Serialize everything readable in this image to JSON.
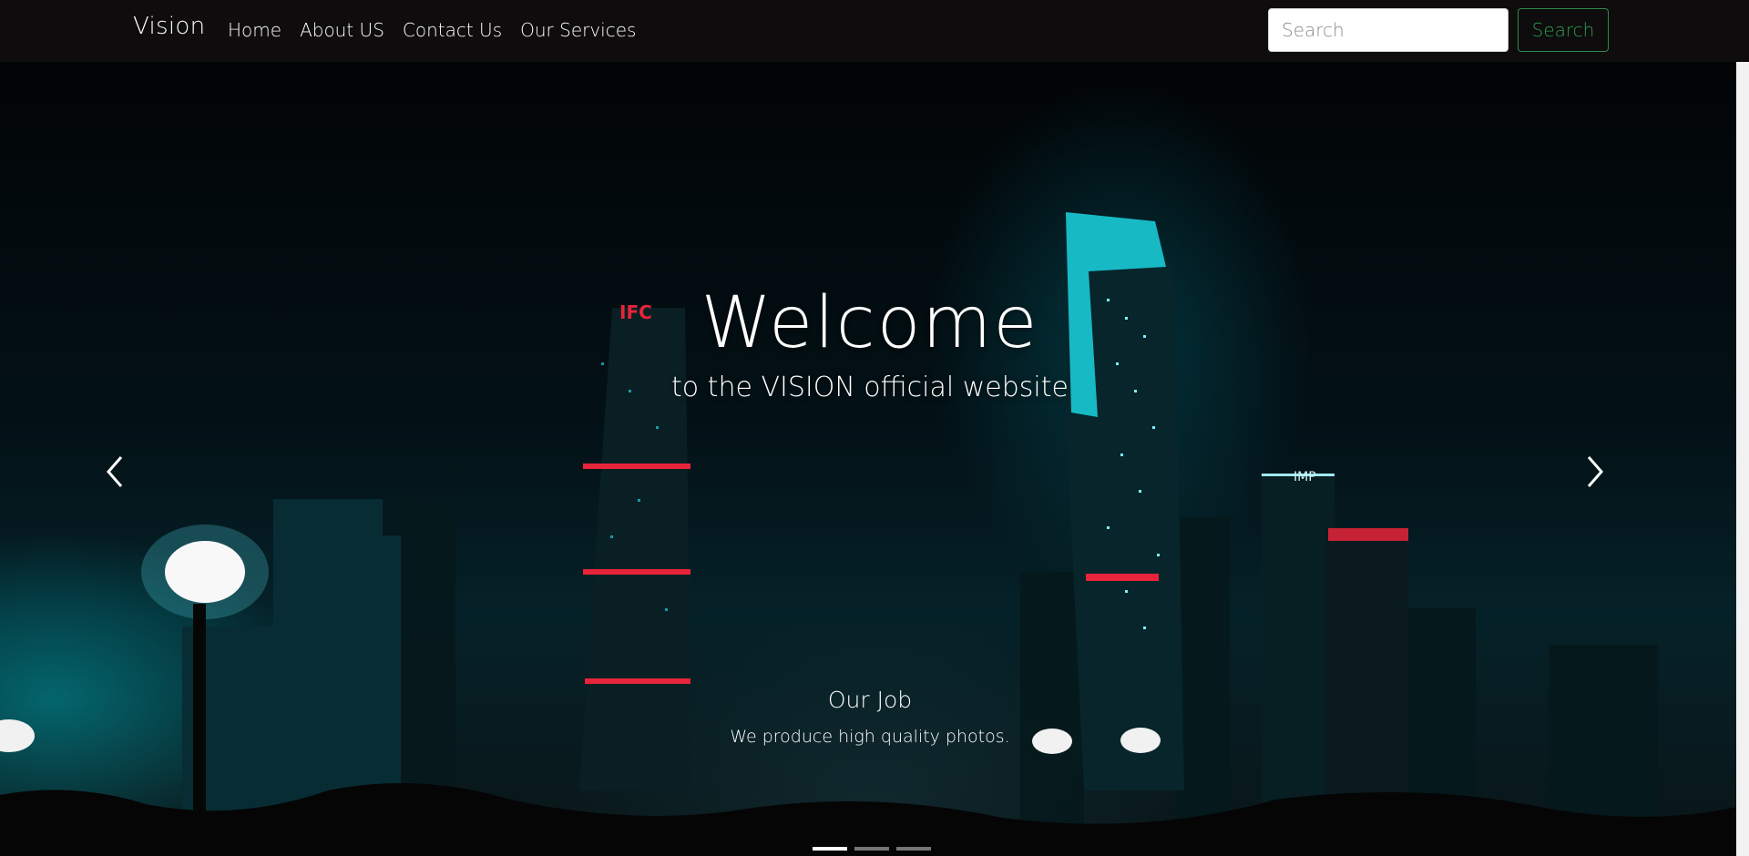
{
  "navbar": {
    "brand": "Vision",
    "links": [
      "Home",
      "About US",
      "Contact Us",
      "Our Services"
    ],
    "search_placeholder": "Search",
    "search_button": "Search"
  },
  "hero": {
    "title": "Welcome",
    "subtitle": "to the VISION official website",
    "caption_title": "Our Job",
    "caption_text": "We produce high quality photos.",
    "active_slide": 1,
    "slide_count": 3
  },
  "colors": {
    "navbar_bg": "#0e0c0d",
    "search_button_accent": "#2f9a52",
    "skyline_cyan": "#1ad3e0",
    "skyline_red": "#e8243a"
  },
  "icons": {
    "prev": "chevron-left-icon",
    "next": "chevron-right-icon"
  }
}
